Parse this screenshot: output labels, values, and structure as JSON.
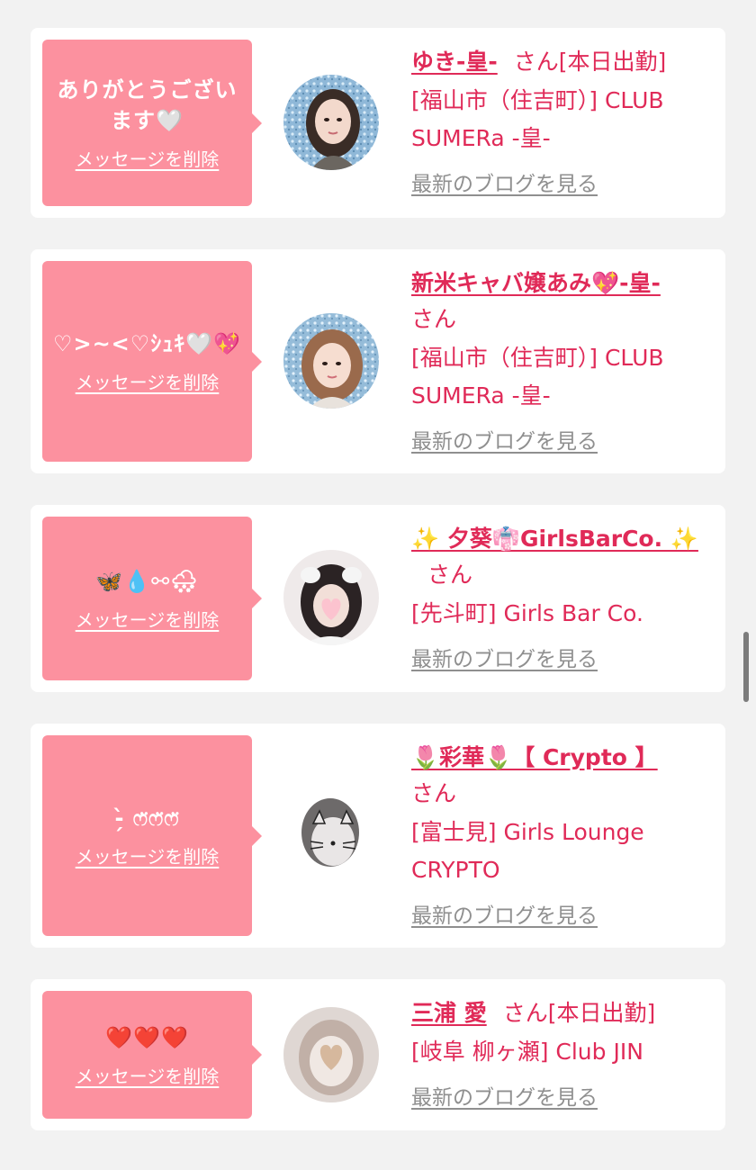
{
  "theme": {
    "bubble": "#fc919f",
    "accent": "#e02a58",
    "link_gray": "#8f8f8f",
    "background": "#f2f2f2"
  },
  "common": {
    "delete_label": "メッセージを削除",
    "blog_label": "最新のブログを見る",
    "san": "さん"
  },
  "cards": [
    {
      "message": "ありがとうございます🤍",
      "name": "ゆき-皇-",
      "status": "[本日出勤]",
      "shop": "[福山市（住吉町）] CLUB SUMERa -皇-",
      "avatar_icon": "profile-photo-woman-sparkle-bg"
    },
    {
      "message": "♡>~<♡ｼｭｷ🤍💖",
      "name": "新米キャバ嬢あみ💖-皇-",
      "status": "",
      "shop": "[福山市（住吉町）] CLUB SUMERa -皇-",
      "avatar_icon": "profile-photo-woman-sparkle-bg"
    },
    {
      "message": "🦋💧⚯🌨",
      "name": "✨ 夕葵👘GirlsBarCo. ✨",
      "status": "",
      "shop": "[先斗町] Girls Bar Co.",
      "avatar_icon": "profile-photo-woman-heart-sticker"
    },
    {
      "message": "-̗̀ ෆ̈ෆ̈ෆ̈",
      "name": "🌷彩華🌷【 Crypto 】",
      "status": "",
      "shop": "[富士見] Girls Lounge CRYPTO",
      "avatar_icon": "profile-photo-woman-cat-drawing"
    },
    {
      "message": "❤️❤️❤️",
      "name": "三浦 愛",
      "status": "[本日出勤]",
      "shop": "[岐阜 柳ヶ瀬] Club JIN",
      "avatar_icon": "profile-photo-blurred-heart"
    }
  ]
}
